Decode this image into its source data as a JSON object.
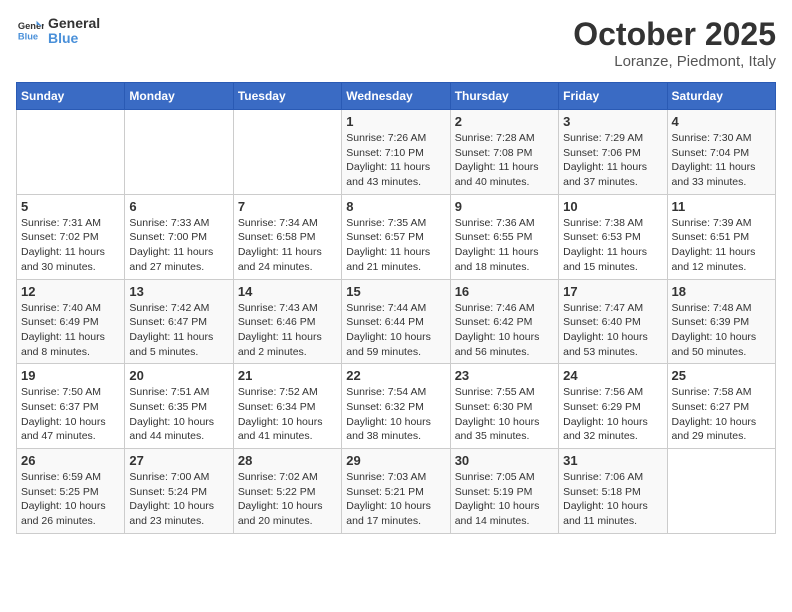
{
  "logo": {
    "line1": "General",
    "line2": "Blue"
  },
  "title": "October 2025",
  "subtitle": "Loranze, Piedmont, Italy",
  "days_of_week": [
    "Sunday",
    "Monday",
    "Tuesday",
    "Wednesday",
    "Thursday",
    "Friday",
    "Saturday"
  ],
  "weeks": [
    [
      {
        "num": "",
        "info": ""
      },
      {
        "num": "",
        "info": ""
      },
      {
        "num": "",
        "info": ""
      },
      {
        "num": "1",
        "info": "Sunrise: 7:26 AM\nSunset: 7:10 PM\nDaylight: 11 hours and 43 minutes."
      },
      {
        "num": "2",
        "info": "Sunrise: 7:28 AM\nSunset: 7:08 PM\nDaylight: 11 hours and 40 minutes."
      },
      {
        "num": "3",
        "info": "Sunrise: 7:29 AM\nSunset: 7:06 PM\nDaylight: 11 hours and 37 minutes."
      },
      {
        "num": "4",
        "info": "Sunrise: 7:30 AM\nSunset: 7:04 PM\nDaylight: 11 hours and 33 minutes."
      }
    ],
    [
      {
        "num": "5",
        "info": "Sunrise: 7:31 AM\nSunset: 7:02 PM\nDaylight: 11 hours and 30 minutes."
      },
      {
        "num": "6",
        "info": "Sunrise: 7:33 AM\nSunset: 7:00 PM\nDaylight: 11 hours and 27 minutes."
      },
      {
        "num": "7",
        "info": "Sunrise: 7:34 AM\nSunset: 6:58 PM\nDaylight: 11 hours and 24 minutes."
      },
      {
        "num": "8",
        "info": "Sunrise: 7:35 AM\nSunset: 6:57 PM\nDaylight: 11 hours and 21 minutes."
      },
      {
        "num": "9",
        "info": "Sunrise: 7:36 AM\nSunset: 6:55 PM\nDaylight: 11 hours and 18 minutes."
      },
      {
        "num": "10",
        "info": "Sunrise: 7:38 AM\nSunset: 6:53 PM\nDaylight: 11 hours and 15 minutes."
      },
      {
        "num": "11",
        "info": "Sunrise: 7:39 AM\nSunset: 6:51 PM\nDaylight: 11 hours and 12 minutes."
      }
    ],
    [
      {
        "num": "12",
        "info": "Sunrise: 7:40 AM\nSunset: 6:49 PM\nDaylight: 11 hours and 8 minutes."
      },
      {
        "num": "13",
        "info": "Sunrise: 7:42 AM\nSunset: 6:47 PM\nDaylight: 11 hours and 5 minutes."
      },
      {
        "num": "14",
        "info": "Sunrise: 7:43 AM\nSunset: 6:46 PM\nDaylight: 11 hours and 2 minutes."
      },
      {
        "num": "15",
        "info": "Sunrise: 7:44 AM\nSunset: 6:44 PM\nDaylight: 10 hours and 59 minutes."
      },
      {
        "num": "16",
        "info": "Sunrise: 7:46 AM\nSunset: 6:42 PM\nDaylight: 10 hours and 56 minutes."
      },
      {
        "num": "17",
        "info": "Sunrise: 7:47 AM\nSunset: 6:40 PM\nDaylight: 10 hours and 53 minutes."
      },
      {
        "num": "18",
        "info": "Sunrise: 7:48 AM\nSunset: 6:39 PM\nDaylight: 10 hours and 50 minutes."
      }
    ],
    [
      {
        "num": "19",
        "info": "Sunrise: 7:50 AM\nSunset: 6:37 PM\nDaylight: 10 hours and 47 minutes."
      },
      {
        "num": "20",
        "info": "Sunrise: 7:51 AM\nSunset: 6:35 PM\nDaylight: 10 hours and 44 minutes."
      },
      {
        "num": "21",
        "info": "Sunrise: 7:52 AM\nSunset: 6:34 PM\nDaylight: 10 hours and 41 minutes."
      },
      {
        "num": "22",
        "info": "Sunrise: 7:54 AM\nSunset: 6:32 PM\nDaylight: 10 hours and 38 minutes."
      },
      {
        "num": "23",
        "info": "Sunrise: 7:55 AM\nSunset: 6:30 PM\nDaylight: 10 hours and 35 minutes."
      },
      {
        "num": "24",
        "info": "Sunrise: 7:56 AM\nSunset: 6:29 PM\nDaylight: 10 hours and 32 minutes."
      },
      {
        "num": "25",
        "info": "Sunrise: 7:58 AM\nSunset: 6:27 PM\nDaylight: 10 hours and 29 minutes."
      }
    ],
    [
      {
        "num": "26",
        "info": "Sunrise: 6:59 AM\nSunset: 5:25 PM\nDaylight: 10 hours and 26 minutes."
      },
      {
        "num": "27",
        "info": "Sunrise: 7:00 AM\nSunset: 5:24 PM\nDaylight: 10 hours and 23 minutes."
      },
      {
        "num": "28",
        "info": "Sunrise: 7:02 AM\nSunset: 5:22 PM\nDaylight: 10 hours and 20 minutes."
      },
      {
        "num": "29",
        "info": "Sunrise: 7:03 AM\nSunset: 5:21 PM\nDaylight: 10 hours and 17 minutes."
      },
      {
        "num": "30",
        "info": "Sunrise: 7:05 AM\nSunset: 5:19 PM\nDaylight: 10 hours and 14 minutes."
      },
      {
        "num": "31",
        "info": "Sunrise: 7:06 AM\nSunset: 5:18 PM\nDaylight: 10 hours and 11 minutes."
      },
      {
        "num": "",
        "info": ""
      }
    ]
  ]
}
